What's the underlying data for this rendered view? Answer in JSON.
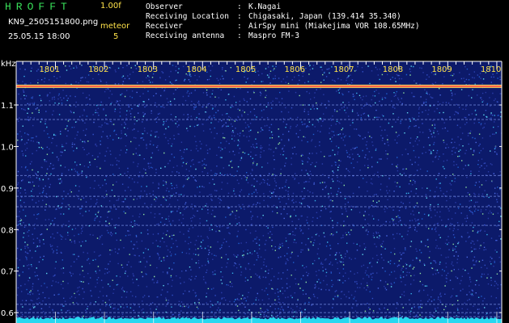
{
  "header": {
    "app_title": "HROFFT",
    "version": "1.00f",
    "filename": "KN9_2505151800.png",
    "date": "25.05.15 18:00",
    "meteor_label": "meteor",
    "meteor_count": "5"
  },
  "metadata": [
    {
      "key": "Observer",
      "sep": ":",
      "value": "K.Nagai"
    },
    {
      "key": "Receiving Location",
      "sep": ":",
      "value": "Chigasaki, Japan (139.414 35.340)"
    },
    {
      "key": "Receiver",
      "sep": ":",
      "value": "AirSpy mini (Miakejima VOR 108.65MHz)"
    },
    {
      "key": "Receiving antenna",
      "sep": ":",
      "value": "Maspro FM-3"
    }
  ],
  "chart_data": {
    "type": "heatmap",
    "ylabel": "kHz",
    "x_ticks": [
      "1801",
      "1802",
      "1803",
      "1804",
      "1805",
      "1806",
      "1807",
      "1808",
      "1809",
      "1810"
    ],
    "x_range": [
      1800,
      1810
    ],
    "y_ticks": [
      1.1,
      1.0,
      0.9,
      0.8,
      0.7,
      0.6
    ],
    "y_range": [
      0.575,
      1.205
    ],
    "carrier_khz": 1.145,
    "horizontal_bands_khz": [
      1.1,
      1.065,
      0.93,
      0.88,
      0.855,
      0.81,
      0.62,
      0.6,
      0.59
    ],
    "colors": {
      "background": "#0c1a6a",
      "carrier": "#ff4040",
      "noise_floor": "#27d8f0",
      "tick_text": "#ffe34a",
      "axis": "#ffffff"
    }
  }
}
